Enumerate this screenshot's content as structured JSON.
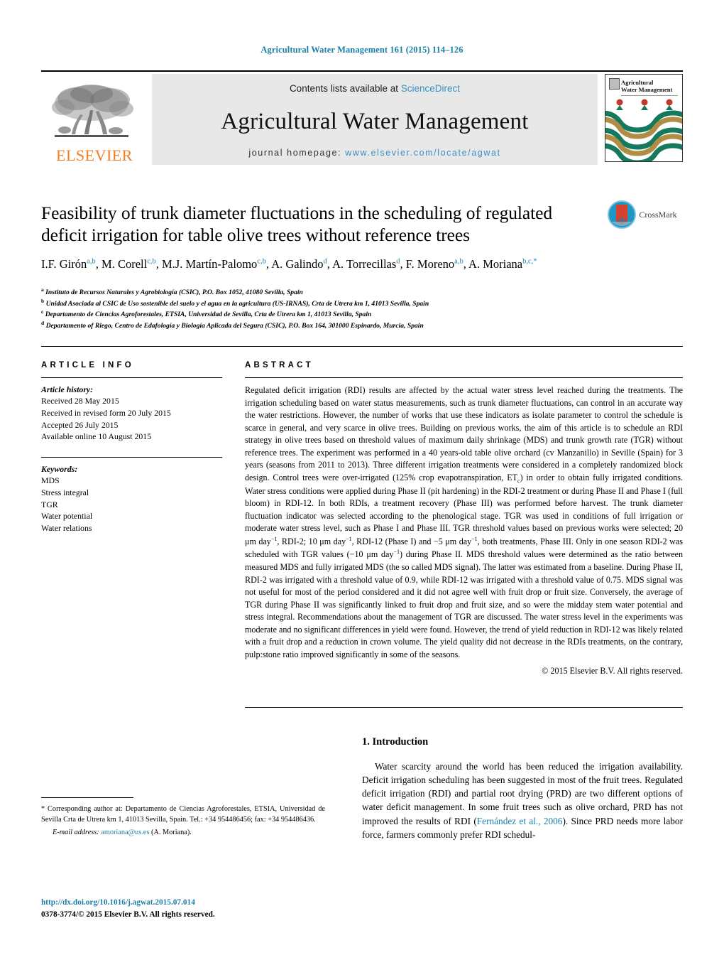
{
  "running_head": "Agricultural Water Management 161 (2015) 114–126",
  "masthead": {
    "publisher_logo_text": "ELSEVIER",
    "contents_prefix": "Contents lists available at ",
    "contents_link": "ScienceDirect",
    "journal_title": "Agricultural Water Management",
    "homepage_prefix": "journal homepage: ",
    "homepage_url": "www.elsevier.com/locate/agwat",
    "cover_title_line1": "Agricultural",
    "cover_title_line2": "Water Management"
  },
  "article": {
    "title": "Feasibility of trunk diameter fluctuations in the scheduling of regulated deficit irrigation for table olive trees without reference trees",
    "authors_line1": "I.F. Girón",
    "authors": [
      {
        "name": "I.F. Girón",
        "sup": "a,b"
      },
      {
        "name": "M. Corell",
        "sup": "c,b"
      },
      {
        "name": "M.J. Martín-Palomo",
        "sup": "c,b"
      },
      {
        "name": "A. Galindo",
        "sup": "d"
      },
      {
        "name": "A. Torrecillas",
        "sup": "d"
      },
      {
        "name": "F. Moreno",
        "sup": "a,b"
      },
      {
        "name": "A. Moriana",
        "sup": "b,c,*"
      }
    ],
    "affiliations": [
      {
        "mark": "a",
        "text": "Instituto de Recursos Naturales y Agrobiología (CSIC), P.O. Box 1052, 41080 Sevilla, Spain"
      },
      {
        "mark": "b",
        "text": "Unidad Asociada al CSIC de Uso sostenible del suelo y el agua en la agricultura (US-IRNAS), Crta de Utrera km 1, 41013 Sevilla, Spain"
      },
      {
        "mark": "c",
        "text": "Departamento de Ciencias Agroforestales, ETSIA, Universidad de Sevilla, Crta de Utrera km 1, 41013 Sevilla, Spain"
      },
      {
        "mark": "d",
        "text": "Departamento of Riego, Centro de Edafología y Biología Aplicada del Segura (CSIC), P.O. Box 164, 301000 Espinardo, Murcia, Spain"
      }
    ],
    "crossmark_label": "CrossMark"
  },
  "article_info": {
    "heading": "ARTICLE INFO",
    "history_label": "Article history:",
    "history": [
      "Received 28 May 2015",
      "Received in revised form 20 July 2015",
      "Accepted 26 July 2015",
      "Available online 10 August 2015"
    ],
    "keywords_label": "Keywords:",
    "keywords": [
      "MDS",
      "Stress integral",
      "TGR",
      "Water potential",
      "Water relations"
    ]
  },
  "abstract": {
    "heading": "ABSTRACT",
    "text": "Regulated deficit irrigation (RDI) results are affected by the actual water stress level reached during the treatments. The irrigation scheduling based on water status measurements, such as trunk diameter fluctuations, can control in an accurate way the water restrictions. However, the number of works that use these indicators as isolate parameter to control the schedule is scarce in general, and very scarce in olive trees. Building on previous works, the aim of this article is to schedule an RDI strategy in olive trees based on threshold values of maximum daily shrinkage (MDS) and trunk growth rate (TGR) without reference trees. The experiment was performed in a 40 years-old table olive orchard (cv Manzanillo) in Seville (Spain) for 3 years (seasons from 2011 to 2013). Three different irrigation treatments were considered in a completely randomized block design. Control trees were over-irrigated (125% crop evapotranspiration, ETc) in order to obtain fully irrigated conditions. Water stress conditions were applied during Phase II (pit hardening) in the RDI-2 treatment or during Phase II and Phase I (full bloom) in RDI-12. In both RDIs, a treatment recovery (Phase III) was performed before harvest. The trunk diameter fluctuation indicator was selected according to the phenological stage. TGR was used in conditions of full irrigation or moderate water stress level, such as Phase I and Phase III. TGR threshold values based on previous works were selected; 20 μm day−1, RDI-2; 10 μm day−1, RDI-12 (Phase I) and −5 μm day−1, both treatments, Phase III. Only in one season RDI-2 was scheduled with TGR values (−10 μm day−1) during Phase II. MDS threshold values were determined as the ratio between measured MDS and fully irrigated MDS (the so called MDS signal). The latter was estimated from a baseline. During Phase II, RDI-2 was irrigated with a threshold value of 0.9, while RDI-12 was irrigated with a threshold value of 0.75. MDS signal was not useful for most of the period considered and it did not agree well with fruit drop or fruit size. Conversely, the average of TGR during Phase II was significantly linked to fruit drop and fruit size, and so were the midday stem water potential and stress integral. Recommendations about the management of TGR are discussed. The water stress level in the experiments was moderate and no significant differences in yield were found. However, the trend of yield reduction in RDI-12 was likely related with a fruit drop and a reduction in crown volume. The yield quality did not decrease in the RDIs treatments, on the contrary, pulp:stone ratio improved significantly in some of the seasons.",
    "copyright": "© 2015 Elsevier B.V. All rights reserved."
  },
  "introduction": {
    "heading": "1. Introduction",
    "paragraph_before_link": "Water scarcity around the world has been reduced the irrigation availability. Deficit irrigation scheduling has been suggested in most of the fruit trees. Regulated deficit irrigation (RDI) and partial root drying (PRD) are two different options of water deficit management. In some fruit trees such as olive orchard, PRD has not improved the results of RDI (",
    "citation_link": "Fernández et al., 2006",
    "paragraph_after_link": "). Since PRD needs more labor force, farmers commonly prefer RDI schedul-"
  },
  "footnote": {
    "corresponding_text": "* Corresponding author at: Departamento de Ciencias Agroforestales, ETSIA, Universidad de Sevilla Crta de Utrera km 1, 41013 Sevilla, Spain. Tel.: +34 954486456; fax: +34 954486436.",
    "email_label": "E-mail address:",
    "email": "amoriana@us.es",
    "email_owner": "(A. Moriana).",
    "doi": "http://dx.doi.org/10.1016/j.agwat.2015.07.014",
    "issn_line": "0378-3774/© 2015 Elsevier B.V. All rights reserved."
  },
  "colors": {
    "link_blue": "#1a7fa8",
    "sciencedirect_blue": "#3a8fc4",
    "elsevier_orange": "#F57C20",
    "masthead_gray": "#e8e8e8"
  }
}
